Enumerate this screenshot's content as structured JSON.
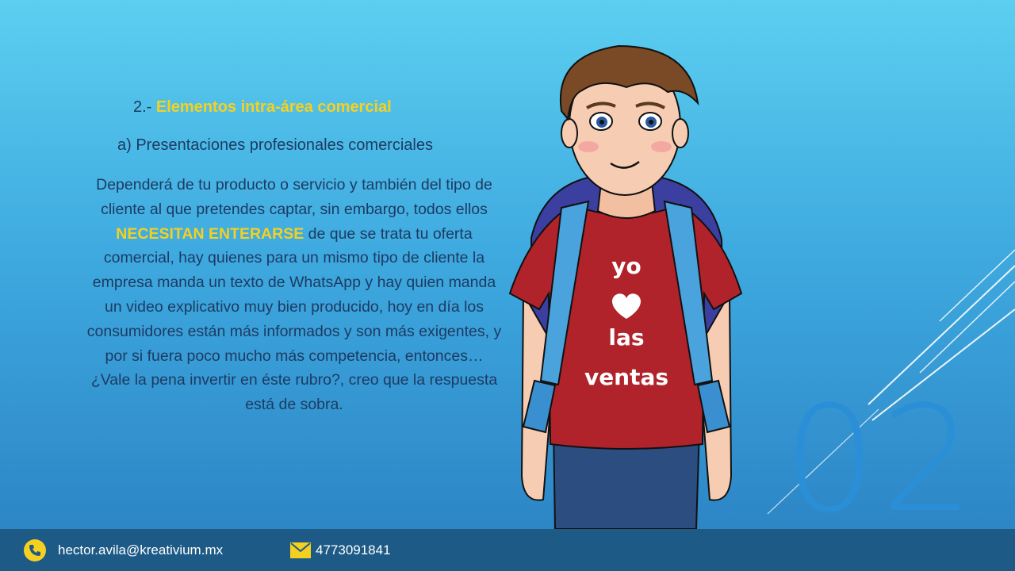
{
  "slide": {
    "title_prefix": "2.- ",
    "title_highlight": "Elementos intra-área comercial",
    "subtitle": "a) Presentaciones profesionales comerciales",
    "body_part1": "Dependerá de tu producto o servicio y también del tipo de cliente al que pretendes captar, sin embargo, todos ellos ",
    "body_highlight": "NECESITAN ENTERARSE",
    "body_part2": " de que se trata tu oferta comercial, hay quienes para un mismo tipo de cliente la empresa manda un texto de WhatsApp y hay quien manda un video explicativo muy bien producido, hoy en día los consumidores están más informados y son más exigentes, y por si fuera poco mucho más competencia, entonces… ¿Vale la pena invertir en éste rubro?, creo que la respuesta está de sobra.",
    "slide_number": "02"
  },
  "illustration": {
    "shirt_line1": "yo",
    "shirt_line3": "las",
    "shirt_line4": "ventas",
    "icon": "heart-icon"
  },
  "footer": {
    "email": "hector.avila@kreativium.mx",
    "phone": "4773091841",
    "phone_icon": "phone-icon",
    "mail_icon": "envelope-icon"
  },
  "colors": {
    "accent": "#f5d020",
    "text": "#1d3b63",
    "footer_bg": "#1d5a86",
    "number": "#2a8fd6"
  }
}
